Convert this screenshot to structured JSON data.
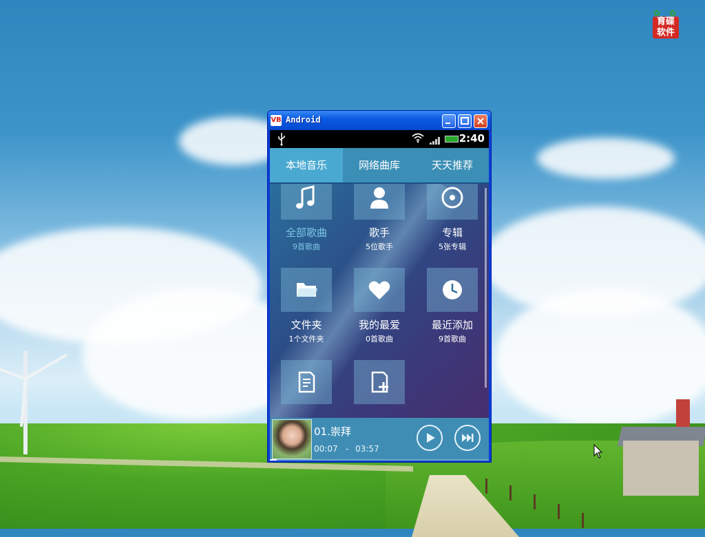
{
  "desktop": {
    "logo_text": "育碟软件"
  },
  "window": {
    "app_icon": "VB",
    "title": "Android",
    "buttons": [
      "minimize-icon",
      "maximize-icon",
      "close-icon"
    ]
  },
  "statusbar": {
    "time": "2:40",
    "icons": [
      "usb-icon",
      "wifi-icon",
      "signal-icon",
      "battery-charging-icon"
    ]
  },
  "tabs": [
    {
      "label": "本地音乐",
      "active": true
    },
    {
      "label": "网络曲库",
      "active": false
    },
    {
      "label": "天天推荐",
      "active": false
    }
  ],
  "tiles": [
    {
      "icon": "music-note-icon",
      "label": "全部歌曲",
      "sub": "9首歌曲"
    },
    {
      "icon": "singer-icon",
      "label": "歌手",
      "sub": "5位歌手"
    },
    {
      "icon": "album-disc-icon",
      "label": "专辑",
      "sub": "5张专辑"
    },
    {
      "icon": "folder-icon",
      "label": "文件夹",
      "sub": "1个文件夹"
    },
    {
      "icon": "heart-icon",
      "label": "我的最爱",
      "sub": "0首歌曲"
    },
    {
      "icon": "clock-icon",
      "label": "最近添加",
      "sub": "9首歌曲"
    },
    {
      "icon": "playlist-icon",
      "label": "",
      "sub": ""
    },
    {
      "icon": "new-playlist-icon",
      "label": "",
      "sub": ""
    }
  ],
  "player": {
    "track_title": "01.崇拜",
    "current_time": "00:07",
    "separator": "-",
    "total_time": "03:57",
    "progress": 0.03,
    "buttons": [
      "play-icon",
      "next-icon"
    ]
  },
  "colors": {
    "titlebar": "#0b5be2",
    "tab_bar": "#3b8fb6",
    "active_tab": "#4aa9d1",
    "player_bar": "#3f8db5",
    "close_button": "#d2401f"
  }
}
